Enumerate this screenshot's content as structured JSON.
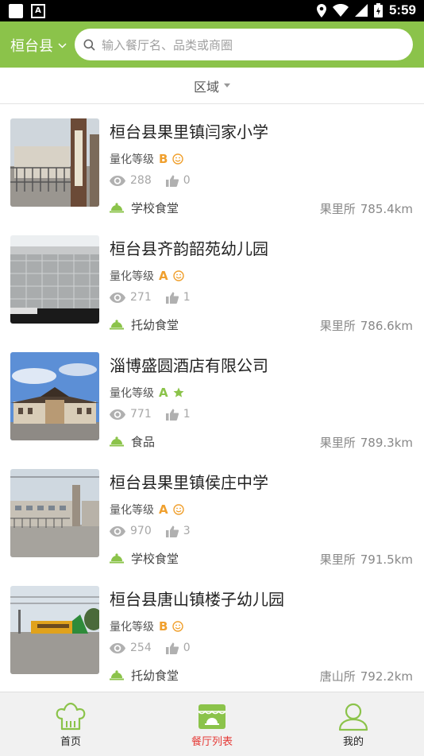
{
  "status_bar": {
    "time": "5:59"
  },
  "header": {
    "city": "桓台县",
    "search_placeholder": "输入餐厅名、品类或商圈"
  },
  "filter": {
    "label": "区域"
  },
  "colors": {
    "brand_green": "#8bc34a",
    "grade_orange": "#f0a02e",
    "grade_green": "#8bc34a",
    "active_tab": "#e53935"
  },
  "restaurants": [
    {
      "name": "桓台县果里镇闫家小学",
      "grade_label": "量化等级",
      "grade": "B",
      "grade_icon": "smile-icon",
      "views": "288",
      "likes": "0",
      "category": "学校食堂",
      "station": "果里所",
      "distance": "785.4km"
    },
    {
      "name": "桓台县齐韵韶苑幼儿园",
      "grade_label": "量化等级",
      "grade": "A",
      "grade_icon": "smile-icon",
      "views": "271",
      "likes": "1",
      "category": "托幼食堂",
      "station": "果里所",
      "distance": "786.6km"
    },
    {
      "name": "淄博盛圆酒店有限公司",
      "grade_label": "量化等级",
      "grade": "A",
      "grade_icon": "star-icon",
      "views": "771",
      "likes": "1",
      "category": "食品",
      "station": "果里所",
      "distance": "789.3km"
    },
    {
      "name": "桓台县果里镇侯庄中学",
      "grade_label": "量化等级",
      "grade": "A",
      "grade_icon": "smile-icon",
      "views": "970",
      "likes": "3",
      "category": "学校食堂",
      "station": "果里所",
      "distance": "791.5km"
    },
    {
      "name": "桓台县唐山镇楼子幼儿园",
      "grade_label": "量化等级",
      "grade": "B",
      "grade_icon": "smile-icon",
      "views": "254",
      "likes": "0",
      "category": "托幼食堂",
      "station": "唐山所",
      "distance": "792.2km"
    }
  ],
  "tabs": [
    {
      "label": "首页",
      "icon": "chef-hat-icon",
      "active": false
    },
    {
      "label": "餐厅列表",
      "icon": "storefront-icon",
      "active": true
    },
    {
      "label": "我的",
      "icon": "user-icon",
      "active": false
    }
  ]
}
